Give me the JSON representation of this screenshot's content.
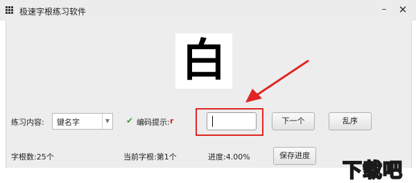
{
  "window": {
    "title": "极速字根练习软件",
    "min_glyph": "–",
    "close_glyph": "✕"
  },
  "display": {
    "character": "白"
  },
  "controls": {
    "practice_label": "练习内容:",
    "practice_value": "键名字",
    "hint_label": "编码提示:",
    "hint_code": "r",
    "answer_value": "",
    "next_button": "下一个",
    "shuffle_button": "乱序",
    "save_button": "保存进度"
  },
  "status": {
    "root_count": "字根数:25个",
    "current_root": "当前字根:第1个",
    "progress": "进度:4.00%"
  },
  "watermark": {
    "text": "下载吧"
  },
  "colors": {
    "annotation_red": "#e02424",
    "hint_red": "#d42020",
    "check_green": "#3a9a3a"
  },
  "icons": {
    "app": "grid-icon",
    "dropdown": "chevron-down-icon",
    "check": "checkmark-icon"
  }
}
